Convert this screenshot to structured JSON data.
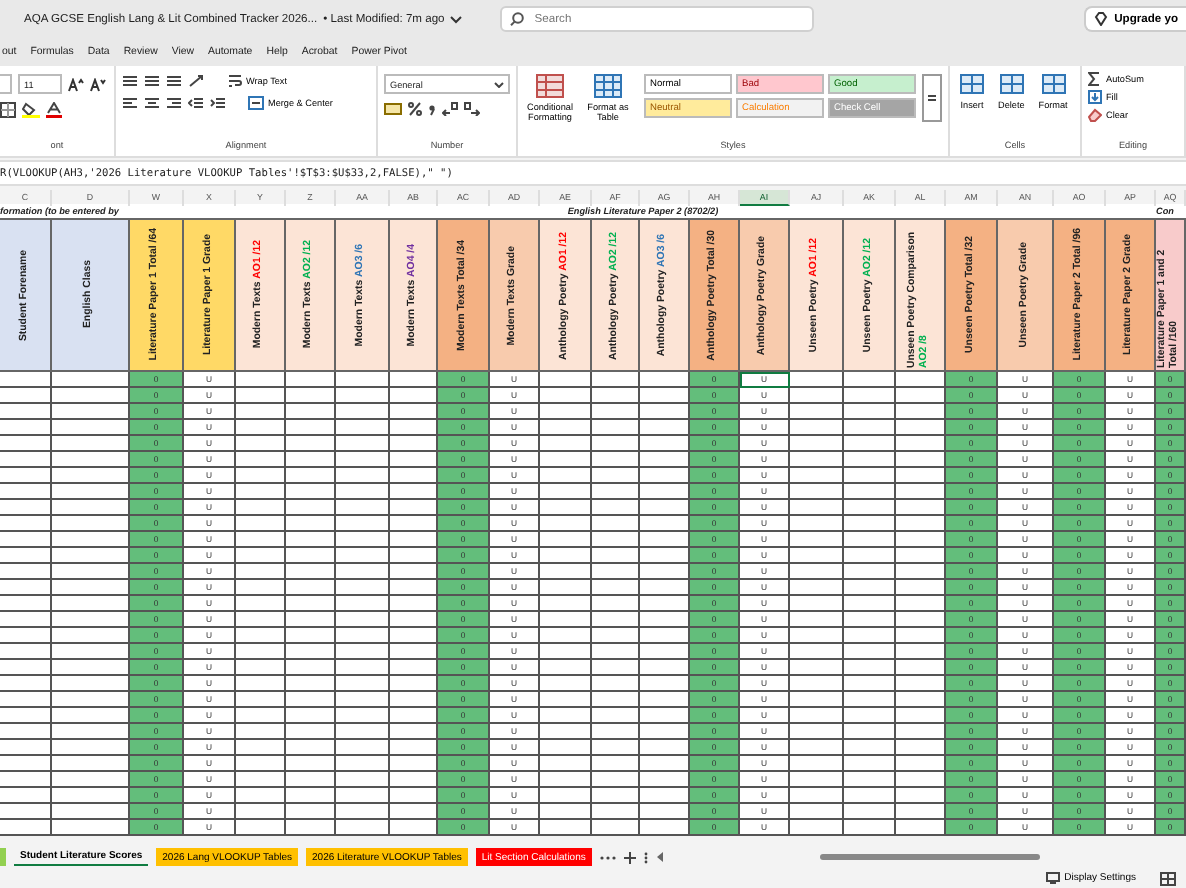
{
  "window": {
    "title": "AQA GCSE English Lang & Lit Combined Tracker 2026...",
    "modified": "• Last Modified: 7m ago",
    "search_placeholder": "Search",
    "upgrade": "Upgrade yo"
  },
  "menu": [
    {
      "label": "out"
    },
    {
      "label": "Formulas"
    },
    {
      "label": "Data"
    },
    {
      "label": "Review"
    },
    {
      "label": "View"
    },
    {
      "label": "Automate"
    },
    {
      "label": "Help"
    },
    {
      "label": "Acrobat"
    },
    {
      "label": "Power Pivot"
    }
  ],
  "ribbon": {
    "font_size": "11",
    "wrap_text": "Wrap Text",
    "merge_center": "Merge & Center",
    "number_format": "General",
    "conditional_formatting": "Conditional Formatting",
    "format_as_table": "Format as Table",
    "styles": [
      {
        "label": "Normal",
        "kind": "normal"
      },
      {
        "label": "Bad",
        "kind": "bad"
      },
      {
        "label": "Good",
        "kind": "good"
      },
      {
        "label": "Neutral",
        "kind": "neutral"
      },
      {
        "label": "Calculation",
        "kind": "calculation"
      },
      {
        "label": "Check Cell",
        "kind": "check"
      }
    ],
    "cells": [
      "Insert",
      "Delete",
      "Format"
    ],
    "editing": [
      "AutoSum",
      "Fill",
      "Clear"
    ],
    "group_labels": [
      "ont",
      "Alignment",
      "Number",
      "Styles",
      "Cells",
      "Editing"
    ]
  },
  "formula": "R(VLOOKUP(AH3,'2026 Literature VLOOKUP Tables'!$T$3:$U$33,2,FALSE),\" \")",
  "group_headers": [
    {
      "text": "formation (to be entered by"
    },
    {
      "text": "English Literature Paper 2 (8702/2)"
    },
    {
      "text": "Con"
    }
  ],
  "columns": [
    {
      "letter": "C",
      "label": "Student Forename",
      "color": "#d9e1f2",
      "selected": false
    },
    {
      "letter": "D",
      "label": "English Class",
      "color": "#d9e1f2",
      "selected": false
    },
    {
      "letter": "W",
      "label": "Literature Paper 1 Total /64",
      "color": "#ffd966",
      "kind": "total",
      "selected": false
    },
    {
      "letter": "X",
      "label": "Literature Paper 1 Grade",
      "color": "#ffd966",
      "selected": false
    },
    {
      "letter": "Y",
      "label": "Modern Texts ",
      "suffix": {
        "text": "AO1 /12",
        "kind": "ao1"
      },
      "color": "#fce4d6",
      "selected": false
    },
    {
      "letter": "Z",
      "label": "Modern Texts ",
      "suffix": {
        "text": "AO2 /12",
        "kind": "ao2"
      },
      "color": "#fce4d6",
      "selected": false
    },
    {
      "letter": "AA",
      "label": "Modern Texts ",
      "suffix": {
        "text": "AO3 /6",
        "kind": "ao3"
      },
      "color": "#fce4d6",
      "selected": false
    },
    {
      "letter": "AB",
      "label": "Modern Texts ",
      "suffix": {
        "text": "AO4 /4",
        "kind": "ao4"
      },
      "color": "#fce4d6",
      "selected": false
    },
    {
      "letter": "AC",
      "label": "Modern Texts Total /34",
      "color": "#f4b183",
      "kind": "total",
      "selected": false
    },
    {
      "letter": "AD",
      "label": "Modern Texts Grade",
      "color": "#f8cbad",
      "selected": false
    },
    {
      "letter": "AE",
      "label": "Anthology Poetry ",
      "suffix": {
        "text": "AO1 /12",
        "kind": "ao1"
      },
      "color": "#fce4d6",
      "selected": false
    },
    {
      "letter": "AF",
      "label": "Anthology Poetry ",
      "suffix": {
        "text": "AO2 /12",
        "kind": "ao2"
      },
      "color": "#fce4d6",
      "selected": false
    },
    {
      "letter": "AG",
      "label": "Anthology Poetry ",
      "suffix": {
        "text": "AO3 /6",
        "kind": "ao3"
      },
      "color": "#fce4d6",
      "selected": false
    },
    {
      "letter": "AH",
      "label": "Anthology Poetry Total /30",
      "color": "#f4b183",
      "kind": "total",
      "selected": false
    },
    {
      "letter": "AI",
      "label": "Anthology Poetry Grade",
      "color": "#f8cbad",
      "selected": true
    },
    {
      "letter": "AJ",
      "label": "Unseen Poetry ",
      "suffix": {
        "text": "AO1 /12",
        "kind": "ao1"
      },
      "color": "#fce4d6",
      "selected": false
    },
    {
      "letter": "AK",
      "label": "Unseen Poetry ",
      "suffix": {
        "text": "AO2 /12",
        "kind": "ao2"
      },
      "color": "#fce4d6",
      "selected": false
    },
    {
      "letter": "AL",
      "label": "Unseen Poetry Comparison ",
      "suffix": {
        "text": "AO2 /8",
        "kind": "ao2"
      },
      "color": "#fce4d6",
      "selected": false
    },
    {
      "letter": "AM",
      "label": "Unseen Poetry Total /32",
      "color": "#f4b183",
      "kind": "total",
      "selected": false
    },
    {
      "letter": "AN",
      "label": "Unseen Poetry Grade",
      "color": "#f8cbad",
      "selected": false
    },
    {
      "letter": "AO",
      "label": "Literature Paper 2 Total /96",
      "color": "#f4b183",
      "kind": "total",
      "selected": false
    },
    {
      "letter": "AP",
      "label": "Literature Paper 2 Grade",
      "color": "#f4b183",
      "selected": false
    },
    {
      "letter": "AQ",
      "label": "Literature Paper 1 and 2 Total /160",
      "color": "#f8cbcb",
      "kind": "total",
      "selected": false
    }
  ],
  "rows": [
    {
      "selected": true,
      "cells": {
        "W": "0",
        "X": "U",
        "AC": "0",
        "AD": "U",
        "AH": "0",
        "AI": "U",
        "AM": "0",
        "AN": "U",
        "AO": "0",
        "AP": "U",
        "AQ": "0"
      }
    },
    {
      "selected": false,
      "cells": {
        "W": "0",
        "X": "U",
        "AC": "0",
        "AD": "U",
        "AH": "0",
        "AI": "U",
        "AM": "0",
        "AN": "U",
        "AO": "0",
        "AP": "U",
        "AQ": "0"
      }
    },
    {
      "selected": false,
      "cells": {
        "W": "0",
        "X": "U",
        "AC": "0",
        "AD": "U",
        "AH": "0",
        "AI": "U",
        "AM": "0",
        "AN": "U",
        "AO": "0",
        "AP": "U",
        "AQ": "0"
      }
    },
    {
      "selected": false,
      "cells": {
        "W": "0",
        "X": "U",
        "AC": "0",
        "AD": "U",
        "AH": "0",
        "AI": "U",
        "AM": "0",
        "AN": "U",
        "AO": "0",
        "AP": "U",
        "AQ": "0"
      }
    },
    {
      "selected": false,
      "cells": {
        "W": "0",
        "X": "U",
        "AC": "0",
        "AD": "U",
        "AH": "0",
        "AI": "U",
        "AM": "0",
        "AN": "U",
        "AO": "0",
        "AP": "U",
        "AQ": "0"
      }
    },
    {
      "selected": false,
      "cells": {
        "W": "0",
        "X": "U",
        "AC": "0",
        "AD": "U",
        "AH": "0",
        "AI": "U",
        "AM": "0",
        "AN": "U",
        "AO": "0",
        "AP": "U",
        "AQ": "0"
      }
    },
    {
      "selected": false,
      "cells": {
        "W": "0",
        "X": "U",
        "AC": "0",
        "AD": "U",
        "AH": "0",
        "AI": "U",
        "AM": "0",
        "AN": "U",
        "AO": "0",
        "AP": "U",
        "AQ": "0"
      }
    },
    {
      "selected": false,
      "cells": {
        "W": "0",
        "X": "U",
        "AC": "0",
        "AD": "U",
        "AH": "0",
        "AI": "U",
        "AM": "0",
        "AN": "U",
        "AO": "0",
        "AP": "U",
        "AQ": "0"
      }
    },
    {
      "selected": false,
      "cells": {
        "W": "0",
        "X": "U",
        "AC": "0",
        "AD": "U",
        "AH": "0",
        "AI": "U",
        "AM": "0",
        "AN": "U",
        "AO": "0",
        "AP": "U",
        "AQ": "0"
      }
    },
    {
      "selected": false,
      "cells": {
        "W": "0",
        "X": "U",
        "AC": "0",
        "AD": "U",
        "AH": "0",
        "AI": "U",
        "AM": "0",
        "AN": "U",
        "AO": "0",
        "AP": "U",
        "AQ": "0"
      }
    },
    {
      "selected": false,
      "cells": {
        "W": "0",
        "X": "U",
        "AC": "0",
        "AD": "U",
        "AH": "0",
        "AI": "U",
        "AM": "0",
        "AN": "U",
        "AO": "0",
        "AP": "U",
        "AQ": "0"
      }
    },
    {
      "selected": false,
      "cells": {
        "W": "0",
        "X": "U",
        "AC": "0",
        "AD": "U",
        "AH": "0",
        "AI": "U",
        "AM": "0",
        "AN": "U",
        "AO": "0",
        "AP": "U",
        "AQ": "0"
      }
    },
    {
      "selected": false,
      "cells": {
        "W": "0",
        "X": "U",
        "AC": "0",
        "AD": "U",
        "AH": "0",
        "AI": "U",
        "AM": "0",
        "AN": "U",
        "AO": "0",
        "AP": "U",
        "AQ": "0"
      }
    },
    {
      "selected": false,
      "cells": {
        "W": "0",
        "X": "U",
        "AC": "0",
        "AD": "U",
        "AH": "0",
        "AI": "U",
        "AM": "0",
        "AN": "U",
        "AO": "0",
        "AP": "U",
        "AQ": "0"
      }
    },
    {
      "selected": false,
      "cells": {
        "W": "0",
        "X": "U",
        "AC": "0",
        "AD": "U",
        "AH": "0",
        "AI": "U",
        "AM": "0",
        "AN": "U",
        "AO": "0",
        "AP": "U",
        "AQ": "0"
      }
    },
    {
      "selected": false,
      "cells": {
        "W": "0",
        "X": "U",
        "AC": "0",
        "AD": "U",
        "AH": "0",
        "AI": "U",
        "AM": "0",
        "AN": "U",
        "AO": "0",
        "AP": "U",
        "AQ": "0"
      }
    },
    {
      "selected": false,
      "cells": {
        "W": "0",
        "X": "U",
        "AC": "0",
        "AD": "U",
        "AH": "0",
        "AI": "U",
        "AM": "0",
        "AN": "U",
        "AO": "0",
        "AP": "U",
        "AQ": "0"
      }
    },
    {
      "selected": false,
      "cells": {
        "W": "0",
        "X": "U",
        "AC": "0",
        "AD": "U",
        "AH": "0",
        "AI": "U",
        "AM": "0",
        "AN": "U",
        "AO": "0",
        "AP": "U",
        "AQ": "0"
      }
    },
    {
      "selected": false,
      "cells": {
        "W": "0",
        "X": "U",
        "AC": "0",
        "AD": "U",
        "AH": "0",
        "AI": "U",
        "AM": "0",
        "AN": "U",
        "AO": "0",
        "AP": "U",
        "AQ": "0"
      }
    },
    {
      "selected": false,
      "cells": {
        "W": "0",
        "X": "U",
        "AC": "0",
        "AD": "U",
        "AH": "0",
        "AI": "U",
        "AM": "0",
        "AN": "U",
        "AO": "0",
        "AP": "U",
        "AQ": "0"
      }
    },
    {
      "selected": false,
      "cells": {
        "W": "0",
        "X": "U",
        "AC": "0",
        "AD": "U",
        "AH": "0",
        "AI": "U",
        "AM": "0",
        "AN": "U",
        "AO": "0",
        "AP": "U",
        "AQ": "0"
      }
    },
    {
      "selected": false,
      "cells": {
        "W": "0",
        "X": "U",
        "AC": "0",
        "AD": "U",
        "AH": "0",
        "AI": "U",
        "AM": "0",
        "AN": "U",
        "AO": "0",
        "AP": "U",
        "AQ": "0"
      }
    },
    {
      "selected": false,
      "cells": {
        "W": "0",
        "X": "U",
        "AC": "0",
        "AD": "U",
        "AH": "0",
        "AI": "U",
        "AM": "0",
        "AN": "U",
        "AO": "0",
        "AP": "U",
        "AQ": "0"
      }
    },
    {
      "selected": false,
      "cells": {
        "W": "0",
        "X": "U",
        "AC": "0",
        "AD": "U",
        "AH": "0",
        "AI": "U",
        "AM": "0",
        "AN": "U",
        "AO": "0",
        "AP": "U",
        "AQ": "0"
      }
    },
    {
      "selected": false,
      "cells": {
        "W": "0",
        "X": "U",
        "AC": "0",
        "AD": "U",
        "AH": "0",
        "AI": "U",
        "AM": "0",
        "AN": "U",
        "AO": "0",
        "AP": "U",
        "AQ": "0"
      }
    },
    {
      "selected": false,
      "cells": {
        "W": "0",
        "X": "U",
        "AC": "0",
        "AD": "U",
        "AH": "0",
        "AI": "U",
        "AM": "0",
        "AN": "U",
        "AO": "0",
        "AP": "U",
        "AQ": "0"
      }
    },
    {
      "selected": false,
      "cells": {
        "W": "0",
        "X": "U",
        "AC": "0",
        "AD": "U",
        "AH": "0",
        "AI": "U",
        "AM": "0",
        "AN": "U",
        "AO": "0",
        "AP": "U",
        "AQ": "0"
      }
    },
    {
      "selected": false,
      "cells": {
        "W": "0",
        "X": "U",
        "AC": "0",
        "AD": "U",
        "AH": "0",
        "AI": "U",
        "AM": "0",
        "AN": "U",
        "AO": "0",
        "AP": "U",
        "AQ": "0"
      }
    },
    {
      "selected": false,
      "cells": {
        "W": "0",
        "X": "U",
        "AC": "0",
        "AD": "U",
        "AH": "0",
        "AI": "U",
        "AM": "0",
        "AN": "U",
        "AO": "0",
        "AP": "U",
        "AQ": "0"
      }
    }
  ],
  "sheet_tabs": [
    {
      "label": "Student Literature Scores",
      "color": "#ffffff",
      "selected": true
    },
    {
      "label": "2026 Lang VLOOKUP Tables",
      "color": "#ffc000",
      "selected": false
    },
    {
      "label": "2026 Literature VLOOKUP Tables",
      "color": "#ffc000",
      "selected": false
    },
    {
      "label": "Lit Section Calculations",
      "color": "#ff0000",
      "selected": false
    }
  ],
  "status_bar": {
    "display_settings": "Display Settings"
  }
}
